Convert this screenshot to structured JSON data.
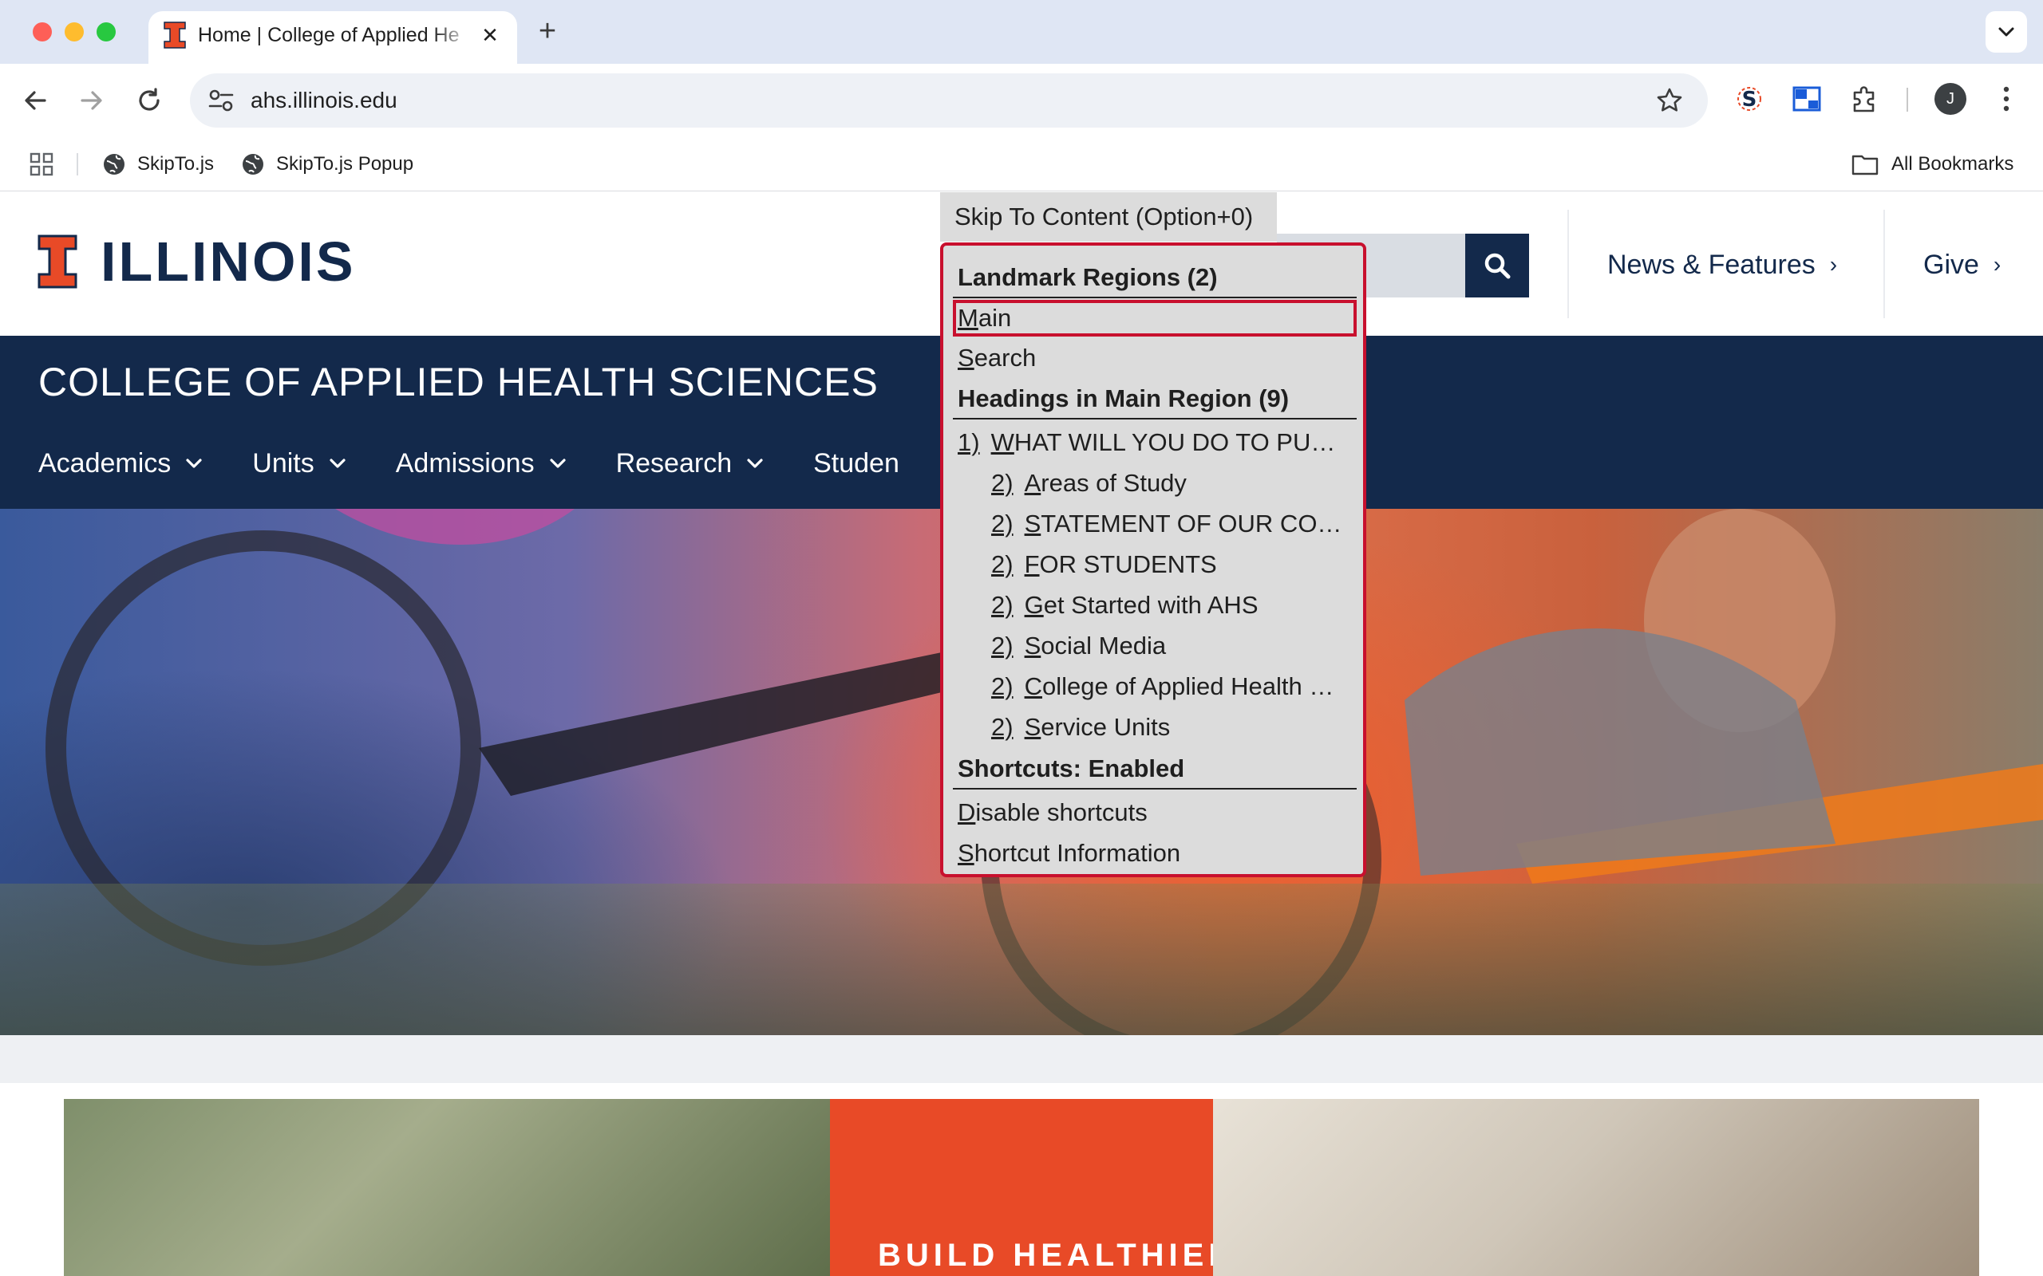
{
  "browser": {
    "tab_title": "Home | College of Applied He",
    "new_tab_symbol": "+",
    "close_symbol": "✕",
    "url": "ahs.illinois.edu",
    "profile_initial": "J",
    "bookmarks": [
      "SkipTo.js",
      "SkipTo.js Popup"
    ],
    "all_bookmarks": "All Bookmarks"
  },
  "site": {
    "logo_text": "ILLINOIS",
    "college_title": "COLLEGE OF APPLIED HEALTH SCIENCES",
    "header_links": [
      {
        "label": "News & Features",
        "chevron": "›"
      },
      {
        "label": "Give",
        "chevron": "›"
      }
    ],
    "nav": [
      "Academics",
      "Units",
      "Admissions",
      "Research",
      "Studen"
    ],
    "promo_text": "BUILD HEALTHIER"
  },
  "skipto": {
    "button_label": "Skip To Content (Option+0)",
    "groups": {
      "landmarks": "Landmark Regions (2)",
      "headings": "Headings in Main Region (9)",
      "shortcuts": "Shortcuts: Enabled"
    },
    "landmarks": [
      {
        "first": "M",
        "rest": "ain"
      },
      {
        "first": "S",
        "rest": "earch"
      }
    ],
    "headings": [
      {
        "level": "1)",
        "first": "W",
        "rest": "HAT WILL YOU DO TO PU…"
      },
      {
        "level": "2)",
        "first": "A",
        "rest": "reas of Study"
      },
      {
        "level": "2)",
        "first": "S",
        "rest": "TATEMENT OF OUR CO…"
      },
      {
        "level": "2)",
        "first": "F",
        "rest": "OR STUDENTS"
      },
      {
        "level": "2)",
        "first": "G",
        "rest": "et Started with AHS"
      },
      {
        "level": "2)",
        "first": "S",
        "rest": "ocial Media"
      },
      {
        "level": "2)",
        "first": "C",
        "rest": "ollege of Applied Health …"
      },
      {
        "level": "2)",
        "first": "S",
        "rest": "ervice Units"
      }
    ],
    "shortcut_items": [
      {
        "first": "D",
        "rest": "isable shortcuts"
      },
      {
        "first": "S",
        "rest": "hortcut Information"
      }
    ]
  },
  "colors": {
    "illinois_blue": "#13294B",
    "illinois_orange": "#E84A27",
    "skipto_border": "#C8102E"
  }
}
